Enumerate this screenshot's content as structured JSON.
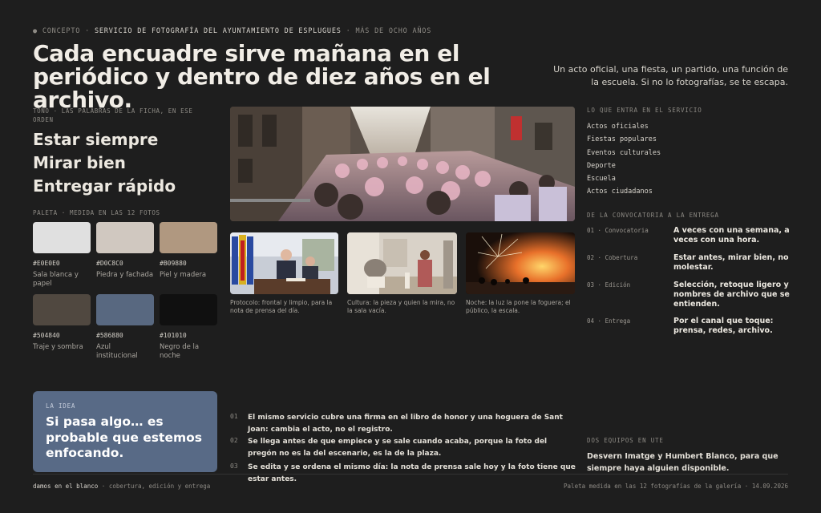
{
  "header": {
    "kicker_concept": "● CONCEPTO",
    "kicker_service": "SERVICIO DE FOTOGRAFÍA DEL AYUNTAMIENTO DE ESPLUGUES",
    "kicker_years": "MÁS DE OCHO AÑOS",
    "headline": "Cada encuadre sirve mañana en el periódico y dentro de diez años en el archivo.",
    "subline": "Un acto oficial, una fiesta, un partido, una función de la escuela. Si no lo fotografías, se te escapa."
  },
  "tone": {
    "label": "TONO · LAS PALABRAS DE LA FICHA, EN ESE ORDEN",
    "items": [
      "Estar siempre",
      "Mirar bien",
      "Entregar rápido"
    ]
  },
  "palette": {
    "label": "PALETA · MEDIDA EN LAS 12 FOTOS",
    "swatches": [
      {
        "hex": "#E0E0E0",
        "name": "Sala blanca y papel"
      },
      {
        "hex": "#D0C8C0",
        "name": "Piedra y fachada"
      },
      {
        "hex": "#B09880",
        "name": "Piel y madera"
      },
      {
        "hex": "#504840",
        "name": "Traje y sombra"
      },
      {
        "hex": "#586880",
        "name": "Azul institucional"
      },
      {
        "hex": "#101010",
        "name": "Negro de la noche"
      }
    ]
  },
  "photos": {
    "captions": [
      "Protocolo: frontal y limpio, para la nota de prensa del día.",
      "Cultura: la pieza y quien la mira, no la sala vacía.",
      "Noche: la luz la pone la foguera; el público, la escala."
    ]
  },
  "service": {
    "label": "LO QUE ENTRA EN EL SERVICIO",
    "items": [
      "Actos oficiales",
      "Fiestas populares",
      "Eventos culturales",
      "Deporte",
      "Escuela",
      "Actos ciudadanos"
    ]
  },
  "process": {
    "label": "DE LA CONVOCATORIA A LA ENTREGA",
    "steps": [
      {
        "num": "01 · Convocatoria",
        "text": "A veces con una semana, a veces con una hora."
      },
      {
        "num": "02 · Cobertura",
        "text": "Estar antes, mirar bien, no molestar."
      },
      {
        "num": "03 · Edición",
        "text": "Selección, retoque ligero y nombres de archivo que se entienden."
      },
      {
        "num": "04 · Entrega",
        "text": "Por el canal que toque: prensa, redes, archivo."
      }
    ]
  },
  "idea": {
    "label": "LA IDEA",
    "text": "Si pasa algo… es probable que estemos enfocando."
  },
  "notes": [
    {
      "num": "01",
      "text": "El mismo servicio cubre una firma en el libro de honor y una hoguera de Sant Joan: cambia el acto, no el registro."
    },
    {
      "num": "02",
      "text": "Se llega antes de que empiece y se sale cuando acaba, porque la foto del pregón no es la del escenario, es la de la plaza."
    },
    {
      "num": "03",
      "text": "Se edita y se ordena el mismo día: la nota de prensa sale hoy y la foto tiene que estar antes."
    }
  ],
  "teams": {
    "label": "DOS EQUIPOS EN UTE",
    "text": "Desvern Imatge y Humbert Blanco, para que siempre haya alguien disponible."
  },
  "footer": {
    "brand": "damos en el blanco",
    "tagline": "· cobertura, edición y entrega",
    "right": "Paleta medida en las 12 fotografías de la galería · 14.09.2026"
  }
}
